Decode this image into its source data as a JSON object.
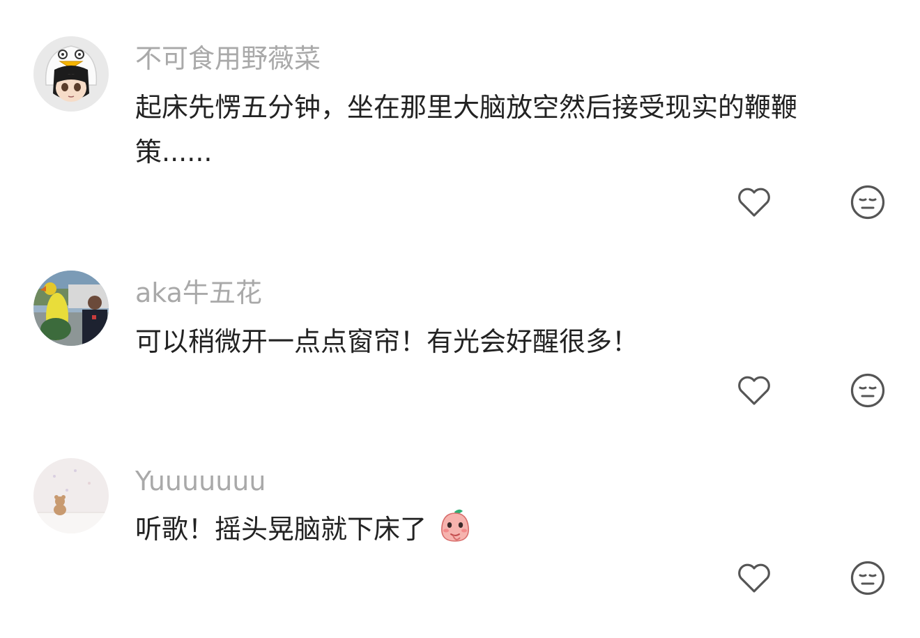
{
  "colors": {
    "username": "#a9a9a9",
    "text": "#222222",
    "icon": "#555555",
    "background": "#ffffff"
  },
  "comments": [
    {
      "username": "不可食用野薇菜",
      "text": "起床先愣五分钟，坐在那里大脑放空然后接受现实的鞭鞭策......",
      "avatar_icon": "avatar-penguin-hat-girl-icon",
      "like_icon": "heart-outline-icon",
      "dislike_icon": "meh-face-icon"
    },
    {
      "username": "aka牛五花",
      "text": "可以稍微开一点点窗帘！有光会好醒很多！",
      "avatar_icon": "avatar-yellow-bird-photo-icon",
      "like_icon": "heart-outline-icon",
      "dislike_icon": "meh-face-icon"
    },
    {
      "username": "Yuuuuuuu",
      "text": "听歌！摇头晃脑就下床了",
      "avatar_icon": "avatar-teddy-bear-icon",
      "inline_emoji": "peach-blush-emoji-icon",
      "like_icon": "heart-outline-icon",
      "dislike_icon": "meh-face-icon"
    }
  ]
}
